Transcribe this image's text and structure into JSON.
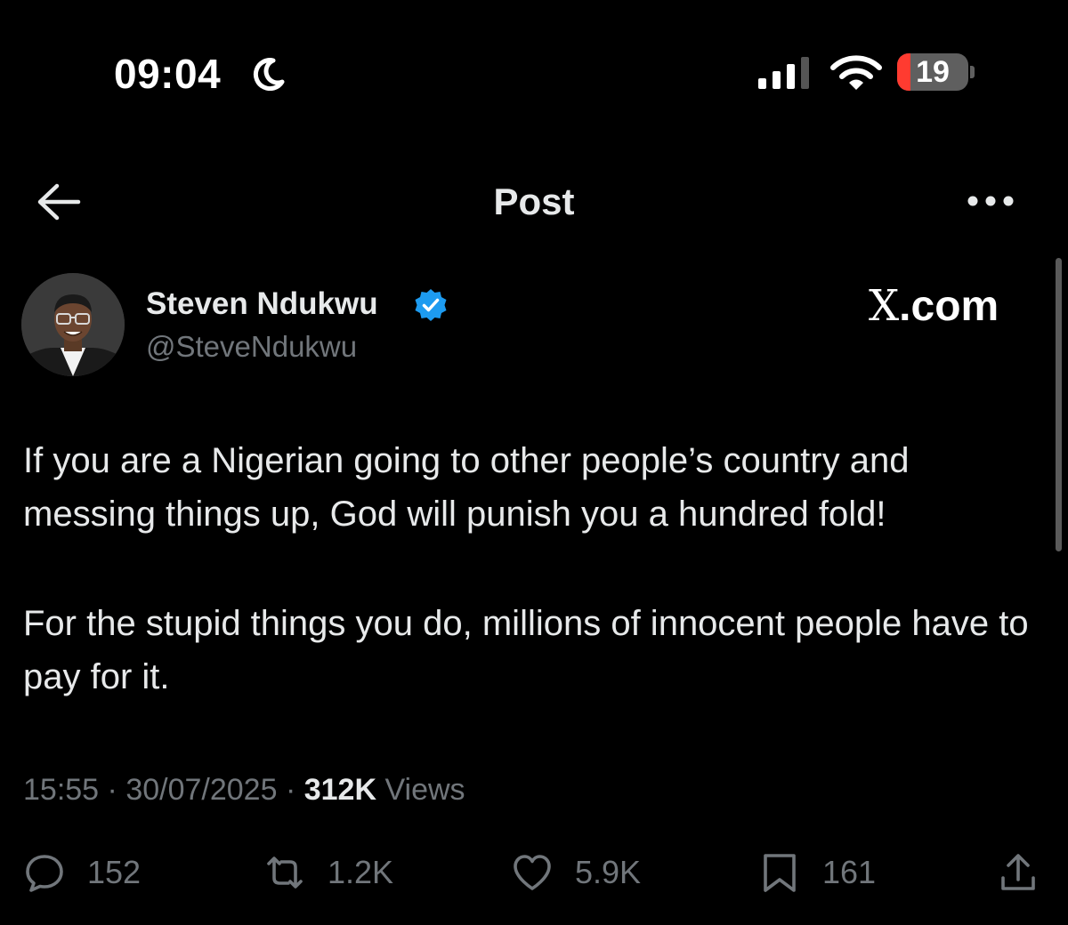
{
  "status_bar": {
    "time": "09:04",
    "battery_level": 19,
    "battery_label": "19"
  },
  "header": {
    "title": "Post"
  },
  "post": {
    "author_name": "Steven Ndukwu",
    "author_handle": "@SteveNdukwu",
    "watermark": {
      "x": "X",
      "domain": ".com"
    },
    "paragraphs": [
      "If you are a Nigerian going to other people’s country and messing things up, God will punish you a hundred fold!",
      "For the stupid things you do, millions of innocent people have to pay for it."
    ],
    "time": "15:55",
    "separator": "·",
    "date": "30/07/2025",
    "views_count": "312K",
    "views_label": "Views"
  },
  "actions": {
    "replies": "152",
    "reposts": "1.2K",
    "likes": "5.9K",
    "bookmarks": "161"
  },
  "colors": {
    "background": "#000000",
    "text": "#e7e9ea",
    "muted": "#71767b",
    "verified": "#1d9bf0",
    "battery_low": "#ff3b30"
  },
  "icons": [
    "moon-icon",
    "signal-icon",
    "wifi-icon",
    "back-arrow-icon",
    "more-icon",
    "verified-badge-icon",
    "reply-icon",
    "repost-icon",
    "like-icon",
    "bookmark-icon",
    "share-icon"
  ]
}
